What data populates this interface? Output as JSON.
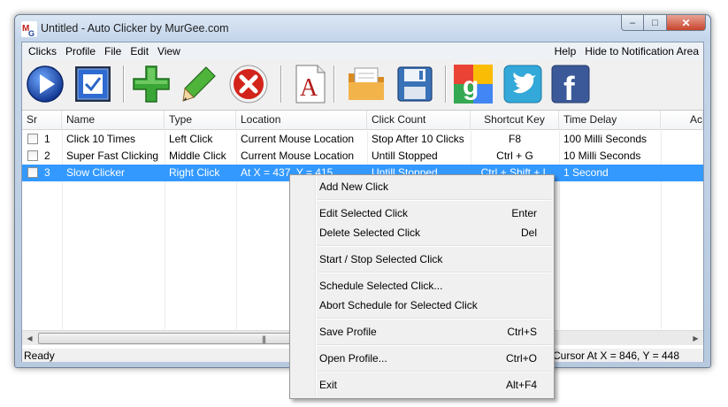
{
  "window": {
    "title": "Untitled - Auto Clicker by MurGee.com",
    "logo_text": "MG",
    "controls": {
      "minimize": "–",
      "maximize": "□",
      "close": "✕"
    }
  },
  "menu": {
    "left": [
      "Clicks",
      "Profile",
      "File",
      "Edit",
      "View"
    ],
    "right": [
      "Help",
      "Hide to Notification Area"
    ]
  },
  "toolbar": {
    "buttons": [
      {
        "name": "play-icon",
        "color": "#1d57c6"
      },
      {
        "name": "checkmark-icon",
        "color": "#2b64c8"
      },
      {
        "name": "add-icon",
        "color": "#3aa637"
      },
      {
        "name": "pencil-icon",
        "color": "#4fb43a"
      },
      {
        "name": "delete-icon",
        "color": "#d2241a"
      },
      {
        "name": "font-icon",
        "color": "#b31b1b"
      },
      {
        "name": "open-folder-icon",
        "color": "#e8a33a"
      },
      {
        "name": "save-icon",
        "color": "#3a72b8"
      },
      {
        "name": "google-icon",
        "color": "#4285f4"
      },
      {
        "name": "twitter-icon",
        "color": "#33a8d9"
      },
      {
        "name": "facebook-icon",
        "color": "#3b5998"
      }
    ],
    "font_glyph": "A",
    "google_glyph": "g",
    "facebook_glyph": "f"
  },
  "list": {
    "columns": [
      "Sr",
      "Name",
      "Type",
      "Location",
      "Click Count",
      "Shortcut Key",
      "Time Delay",
      "Ac"
    ],
    "rows": [
      {
        "sr": "1",
        "name": "Click 10 Times",
        "type": "Left Click",
        "location": "Current Mouse Location",
        "count": "Stop After 10 Clicks",
        "shortcut": "F8",
        "delay": "100 Milli Seconds"
      },
      {
        "sr": "2",
        "name": "Super Fast Clicking",
        "type": "Middle Click",
        "location": "Current Mouse Location",
        "count": "Untill Stopped",
        "shortcut": "Ctrl + G",
        "delay": "10 Milli Seconds"
      },
      {
        "sr": "3",
        "name": "Slow Clicker",
        "type": "Right Click",
        "location": "At X = 437, Y = 415",
        "count": "Untill Stopped",
        "shortcut": "Ctrl + Shift + L",
        "delay": "1 Second"
      }
    ],
    "selected_row": "3",
    "scroll_grip": "|||"
  },
  "status": {
    "left": "Ready",
    "right": "Cursor At X = 846, Y = 448"
  },
  "context_menu": {
    "items": [
      {
        "label": "Add New Click",
        "key": ""
      },
      {
        "label": "Edit Selected Click",
        "key": "Enter"
      },
      {
        "label": "Delete Selected Click",
        "key": "Del"
      },
      {
        "label": "Start / Stop Selected Click",
        "key": ""
      },
      {
        "label": "Schedule Selected Click...",
        "key": ""
      },
      {
        "label": "Abort Schedule for Selected Click",
        "key": ""
      },
      {
        "label": "Save Profile",
        "key": "Ctrl+S"
      },
      {
        "label": "Open Profile...",
        "key": "Ctrl+O"
      },
      {
        "label": "Exit",
        "key": "Alt+F4"
      }
    ]
  },
  "colors": {
    "selection": "#3399ff",
    "title_gradient_top": "#dce7f4",
    "close_button": "#c8442c"
  }
}
